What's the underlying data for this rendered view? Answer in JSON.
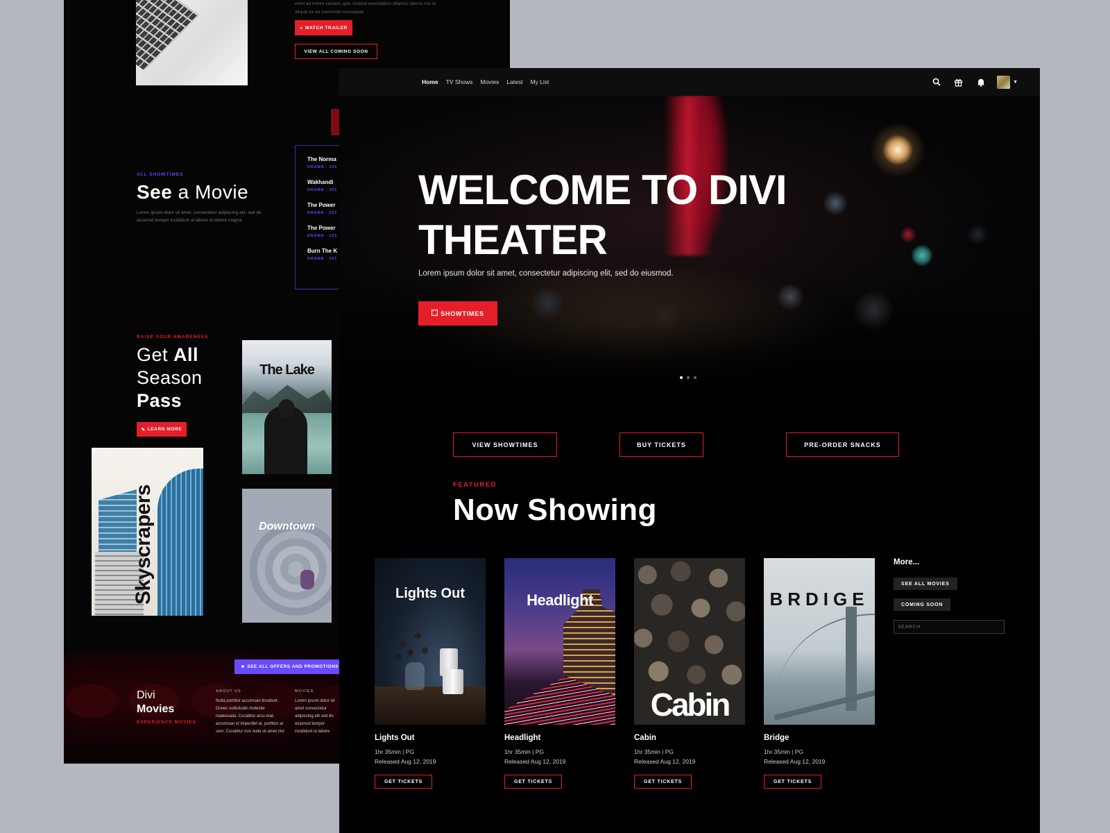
{
  "back": {
    "lorem_top": "enim ad minim veniam, quis nostrud exercitation ullamco laboris nisi ut aliquip ex ea commodo consequat.",
    "watch_trailer": "WATCH TRAILER",
    "view_all_coming_soon": "VIEW ALL COMING SOON",
    "showtimes_eyebrow": "ALL SHOWTIMES",
    "see_bold": "See",
    "see_rest": "a Movie",
    "see_lorem": "Lorem ipsum dolor sit amet, consectetur adipiscing elit, sed do eiusmod tempor incididunt ut labore et dolore magna",
    "list": [
      {
        "title": "The Norma",
        "sub": "DRAMA - 201"
      },
      {
        "title": "Wakhandi",
        "sub": "DRAMA - 201"
      },
      {
        "title": "The Power",
        "sub": "DRAMA - 201"
      },
      {
        "title": "The Power",
        "sub": "DRAMA - 201"
      },
      {
        "title": "Burn The K",
        "sub": "DRAMA - 201"
      }
    ],
    "pass_eyebrow": "RAISE YOUR AWARENESS",
    "pass_line1": "Get",
    "pass_line1_bold": "All",
    "pass_line2": "Season",
    "pass_line3_bold": "Pass",
    "learn_more": "LEARN MORE",
    "poster_lake": "The Lake",
    "poster_sky": "Skyscrapers",
    "poster_down": "Downtown",
    "promo": "SEE ALL OFFERS AND PROMOTIONS",
    "brand_divi": "Divi",
    "brand_movies": "Movies",
    "brand_tagline": "EXPERIENCE MOVIES",
    "about_heading": "ABOUT US",
    "about_text": "Nulla porttitor accumsan tincidunt. Donec sollicitudin molestie malesuada. Curabitur arcu erat, accumsan id imperdiet et, porttitor at sem. Curabitur non nulla sit amet nisl",
    "movies_heading": "MOVIES",
    "movies_text": "Lorem ipsum dolor sit amet consectetur adipiscing elit sed do eiusmod tempor incididunt ut labore"
  },
  "nav": {
    "links": [
      "Home",
      "TV Shows",
      "Movies",
      "Latest",
      "My List"
    ],
    "icons": [
      "search-icon",
      "gift-icon",
      "bell-icon"
    ]
  },
  "hero": {
    "title": "WELCOME TO DIVI THEATER",
    "subtitle": "Lorem ipsum dolor sit amet, consectetur adipiscing elit, sed do eiusmod.",
    "button": "SHOWTIMES",
    "active_slide": 1,
    "slides": 3
  },
  "cta": {
    "view_showtimes": "VIEW SHOWTIMES",
    "buy_tickets": "BUY TICKETS",
    "pre_order": "PRE-ORDER SNACKS"
  },
  "featured": {
    "eyebrow": "FEATURED",
    "title_bold": "Now",
    "title_rest": "Showing"
  },
  "movies": [
    {
      "poster_title": "Lights Out",
      "name": "Lights Out",
      "runtime": "1hr 35min | PG",
      "released": "Released Aug 12, 2019",
      "button": "GET TICKETS"
    },
    {
      "poster_title": "Headlight",
      "name": "Headlight",
      "runtime": "1hr 35min | PG",
      "released": "Released Aug 12, 2019",
      "button": "GET TICKETS"
    },
    {
      "poster_title": "Cabin",
      "name": "Cabin",
      "runtime": "1hr 35min | PG",
      "released": "Released Aug 12, 2019",
      "button": "GET TICKETS"
    },
    {
      "poster_title": "BRDIGE",
      "name": "Bridge",
      "runtime": "1hr 35min | PG",
      "released": "Released Aug 12, 2019",
      "button": "GET TICKETS"
    }
  ],
  "more": {
    "heading": "More...",
    "see_all": "SEE ALL MOVIES",
    "coming_soon": "COMING SOON",
    "search_placeholder": "SEARCH"
  },
  "colors": {
    "accent_red": "#e51f2a",
    "accent_purple": "#6a4bff",
    "background": "#000000",
    "canvas": "#b3b7bf"
  }
}
